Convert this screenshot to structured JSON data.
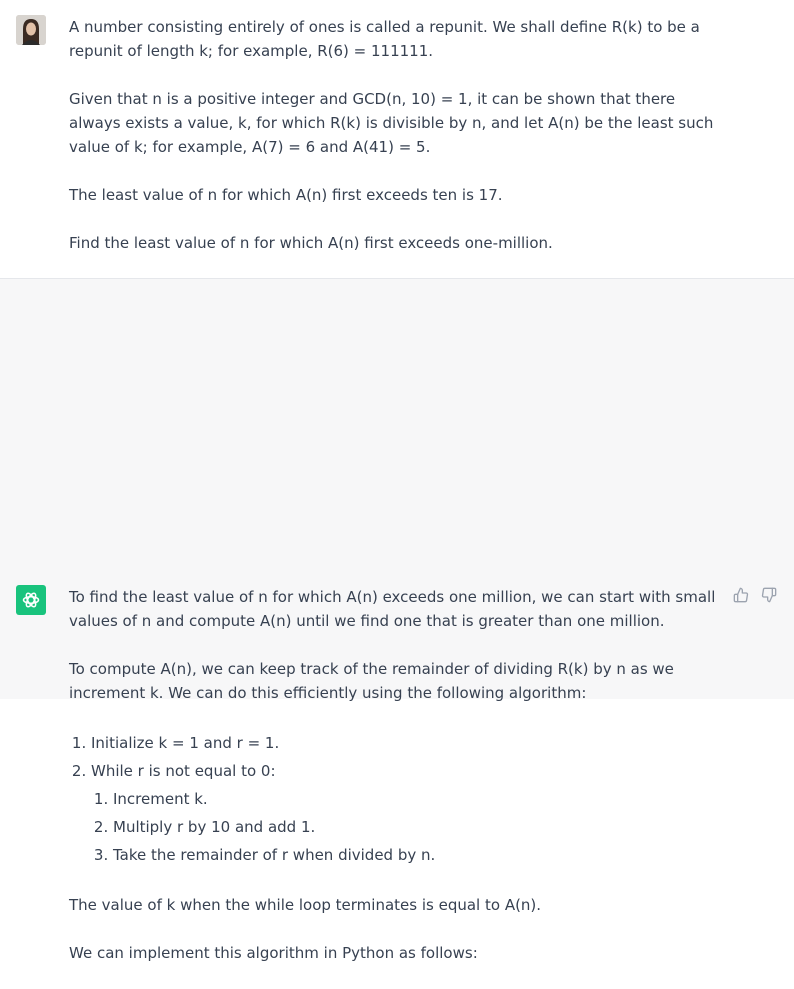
{
  "user_message": {
    "paragraphs": [
      "A number consisting entirely of ones is called a repunit. We shall define R(k) to be a repunit of length k; for example, R(6) = 111111.",
      "Given that n is a positive integer and GCD(n, 10) = 1, it can be shown that there always exists a value, k, for which R(k) is divisible by n, and let A(n) be the least such value of k; for example, A(7) = 6 and A(41) = 5.",
      "The least value of n for which A(n) first exceeds ten is 17.",
      "Find the least value of n for which A(n) first exceeds one-million."
    ]
  },
  "assistant_message": {
    "intro": "To find the least value of n for which A(n) exceeds one million, we can start with small values of n and compute A(n) until we find one that is greater than one million.",
    "compute": "To compute A(n), we can keep track of the remainder of dividing R(k) by n as we increment k. We can do this efficiently using the following algorithm:",
    "steps": [
      "Initialize k = 1 and r = 1.",
      "While r is not equal to 0:"
    ],
    "substeps": [
      "Increment k.",
      "Multiply r by 10 and add 1.",
      "Take the remainder of r when divided by n."
    ],
    "conclusion": "The value of k when the while loop terminates is equal to A(n).",
    "implement": "We can implement this algorithm in Python as follows:"
  },
  "icons": {
    "user_avatar": "user-avatar",
    "assistant_avatar": "openai-logo-icon",
    "thumbs_up": "thumbs-up-icon",
    "thumbs_down": "thumbs-down-icon"
  },
  "colors": {
    "assistant_bg": "#f7f7f8",
    "avatar_green": "#19c37d",
    "text": "#374151"
  }
}
